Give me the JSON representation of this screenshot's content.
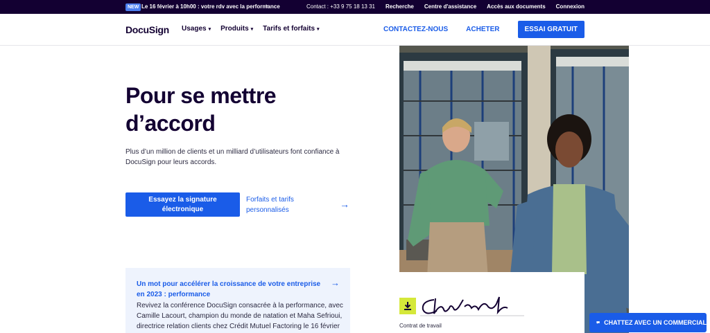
{
  "announcement": {
    "badge": "NEW",
    "message": "Le 16 février à 10h00 : votre rdv avec la performance",
    "links": [
      "Contact : +33 9 75 18 13 31",
      "Recherche",
      "Centre d'assistance",
      "Accès aux documents",
      "Connexion"
    ]
  },
  "nav": {
    "logo": "DocuSign",
    "menu": [
      {
        "label": "Usages"
      },
      {
        "label": "Produits"
      },
      {
        "label": "Tarifs et forfaits"
      }
    ],
    "contact_label": "CONTACTEZ-NOUS",
    "buy_label": "ACHETER",
    "trial_label": "ESSAI GRATUIT"
  },
  "hero": {
    "title": "Pour se mettre d’accord",
    "description": "Plus d’un million de clients et un milliard d’utilisateurs font confiance à DocuSign pour leurs accords.",
    "cta_primary": "Essayez la signature électronique",
    "cta_secondary": "Forfaits et tarifs personnalisés"
  },
  "news": {
    "title": "Un mot pour accélérer la croissance de votre entreprise en 2023 : performance",
    "text": "Revivez la conférence DocuSign consacrée à la performance, avec Camille Lacourt, champion du monde de natation et Maha Sefrioui, directrice relation clients chez Crédit Mutuel Factoring le 16 février"
  },
  "signature_card": {
    "caption": "Contrat de travail"
  },
  "chat": {
    "label": "CHATTEZ AVEC UN COMMERCIAL"
  },
  "colors": {
    "brand_blue": "#1a5ce8",
    "dark_navy": "#130032",
    "accent_yellow": "#d5e83a"
  }
}
